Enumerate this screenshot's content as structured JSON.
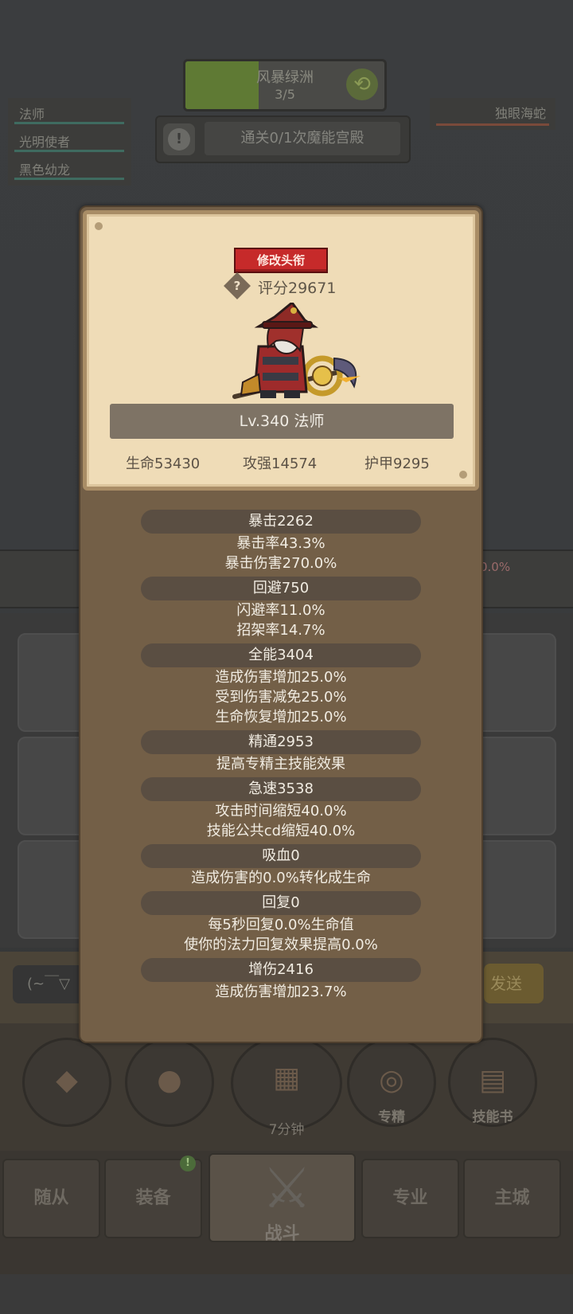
{
  "zone": {
    "name": "风暴绿洲",
    "progress": "3/5"
  },
  "quest": {
    "text": "通关0/1次魔能宫殿"
  },
  "team": [
    {
      "name": "法师"
    },
    {
      "name": "光明使者"
    },
    {
      "name": "黑色幼龙"
    }
  ],
  "enemy": {
    "name": "独眼海蛇"
  },
  "background": {
    "percent_text": "0.0%",
    "chat_text": "(~￣▽",
    "send_label": "发送"
  },
  "actions": {
    "timer": "7分钟",
    "specialize_label": "专精",
    "skillbook_label": "技能书"
  },
  "tabs": {
    "followers": "随从",
    "equipment": "装备",
    "equipment_badge": "!",
    "fight": "战斗",
    "profession": "专业",
    "city": "主城"
  },
  "card": {
    "edit_title_button": "修改头衔",
    "help_icon": "?",
    "score": "评分29671",
    "level_class": "Lv.340 法师",
    "hp": "生命53430",
    "attack": "攻强14574",
    "armor": "护甲9295"
  },
  "stats": [
    {
      "header": "暴击2262",
      "lines": [
        "暴击率43.3%",
        "暴击伤害270.0%"
      ]
    },
    {
      "header": "回避750",
      "lines": [
        "闪避率11.0%",
        "招架率14.7%"
      ]
    },
    {
      "header": "全能3404",
      "lines": [
        "造成伤害增加25.0%",
        "受到伤害减免25.0%",
        "生命恢复增加25.0%"
      ]
    },
    {
      "header": "精通2953",
      "lines": [
        "提高专精主技能效果"
      ]
    },
    {
      "header": "急速3538",
      "lines": [
        "攻击时间缩短40.0%",
        "技能公共cd缩短40.0%"
      ]
    },
    {
      "header": "吸血0",
      "lines": [
        "造成伤害的0.0%转化成生命"
      ]
    },
    {
      "header": "回复0",
      "lines": [
        "每5秒回复0.0%生命值",
        "使你的法力回复效果提高0.0%"
      ]
    },
    {
      "header": "增伤2416",
      "lines": [
        "造成伤害增加23.7%"
      ]
    }
  ]
}
